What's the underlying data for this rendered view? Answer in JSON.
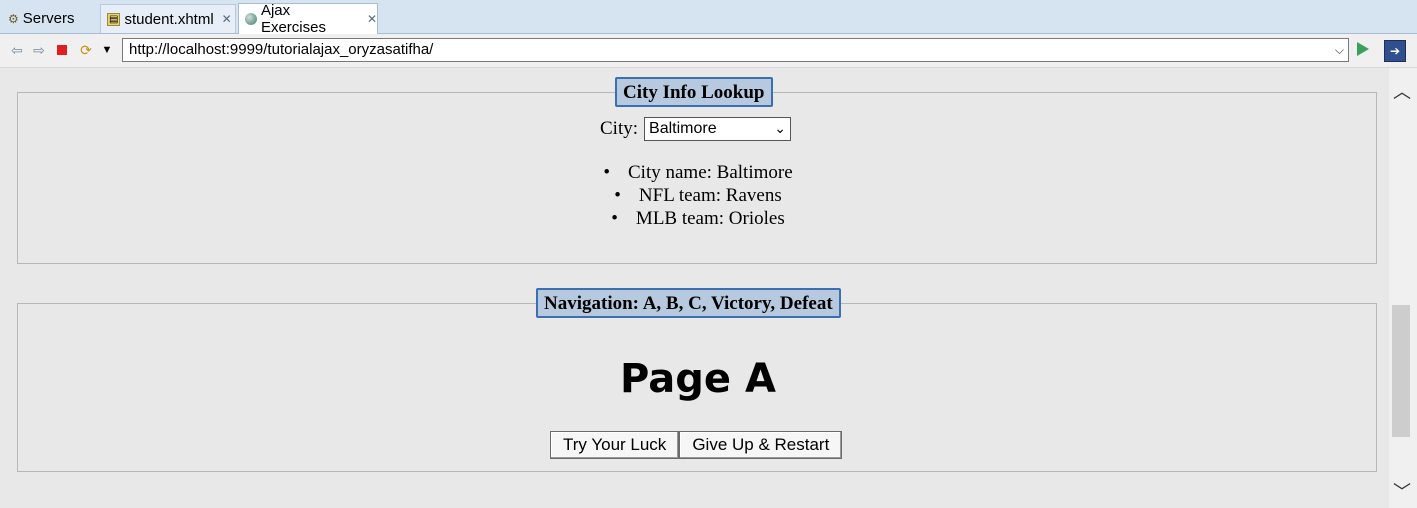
{
  "tabs": [
    {
      "label": "Servers",
      "icon": "servers-icon"
    },
    {
      "label": "student.xhtml",
      "icon": "xhtml-file-icon"
    },
    {
      "label": "Ajax Exercises",
      "icon": "globe-icon"
    }
  ],
  "toolbar": {
    "url": "http://localhost:9999/tutorialajax_oryzasatifha/"
  },
  "city_panel": {
    "legend": "City Info Lookup",
    "city_label": "City:",
    "city_selected": "Baltimore",
    "info": [
      "City name: Baltimore",
      "NFL team: Ravens",
      "MLB team: Orioles"
    ]
  },
  "nav_panel": {
    "legend": "Navigation: A, B, C, Victory, Defeat",
    "page_title": "Page A",
    "btn_try": "Try Your Luck",
    "btn_giveup": "Give Up & Restart"
  },
  "colors": {
    "legend_bg": "#b6c9df",
    "legend_border": "#3b6fb0",
    "content_bg": "#e8e8e8"
  }
}
